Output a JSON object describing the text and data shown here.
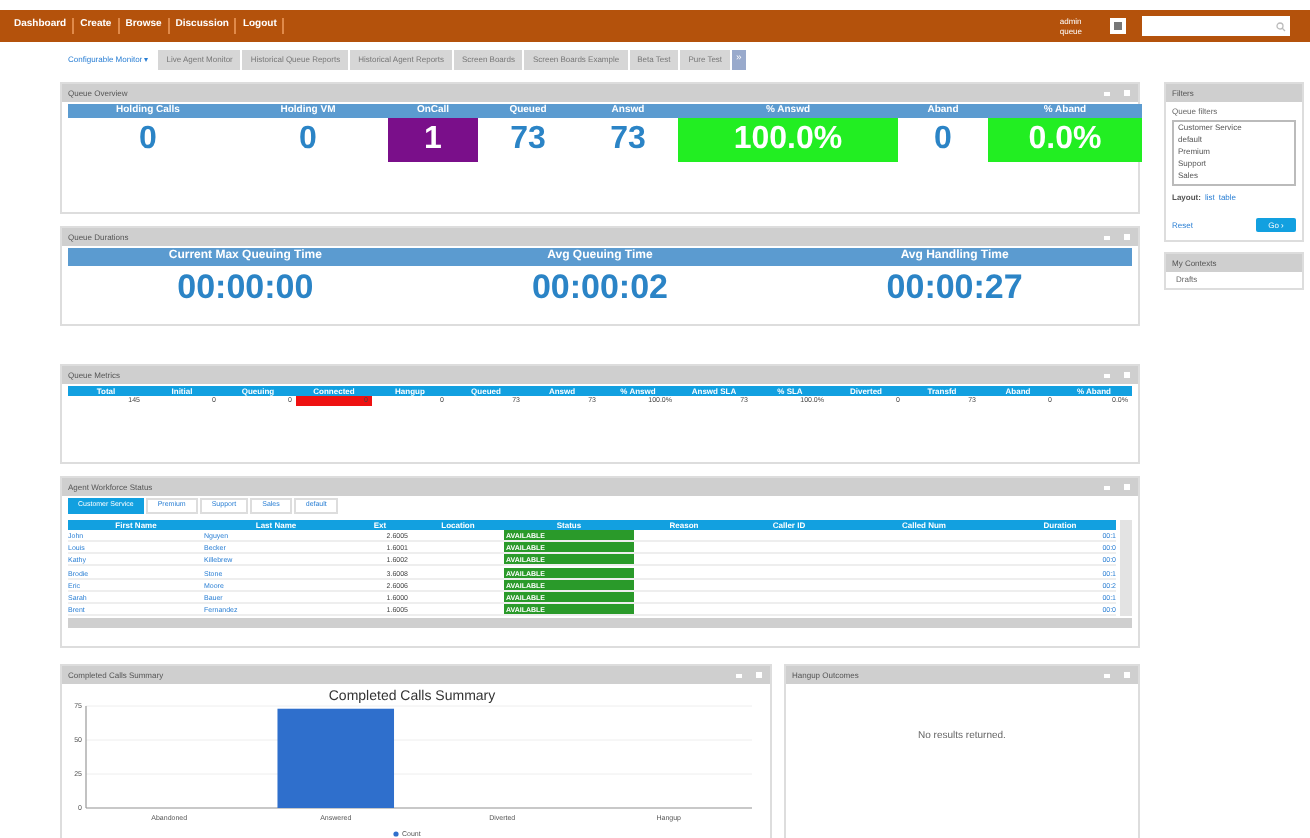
{
  "nav": {
    "items": [
      "Dashboard",
      "Create",
      "Browse",
      "Discussion",
      "Logout"
    ],
    "user": [
      "admin",
      "queue"
    ]
  },
  "tabs": [
    {
      "label": "Configurable Monitor ▾",
      "selected": true
    },
    {
      "label": "Live Agent Monitor",
      "selected": false
    },
    {
      "label": "Historical Queue Reports",
      "selected": false
    },
    {
      "label": "Historical Agent Reports",
      "selected": false
    },
    {
      "label": "Screen Boards",
      "selected": false
    },
    {
      "label": "Screen Boards Example",
      "selected": false
    },
    {
      "label": "Beta Test",
      "selected": false
    },
    {
      "label": "Pure Test",
      "selected": false
    }
  ],
  "tabs_more": "»",
  "queue_overview": {
    "title": "Queue Overview",
    "stats": [
      {
        "label": "Holding Calls",
        "value": "0"
      },
      {
        "label": "Holding VM",
        "value": "0"
      },
      {
        "label": "OnCall",
        "value": "1",
        "color": "#7a0f8a"
      },
      {
        "label": "Queued",
        "value": "73"
      },
      {
        "label": "Answd",
        "value": "73"
      },
      {
        "label": "% Answd",
        "value": "100.0%",
        "color": "#22ee22"
      },
      {
        "label": "Aband",
        "value": "0"
      },
      {
        "label": "% Aband",
        "value": "0.0%",
        "color": "#22ee22"
      }
    ]
  },
  "queue_durations": {
    "title": "Queue Durations",
    "stats": [
      {
        "label": "Current Max Queuing Time",
        "value": "00:00:00"
      },
      {
        "label": "Avg Queuing Time",
        "value": "00:00:02"
      },
      {
        "label": "Avg Handling Time",
        "value": "00:00:27"
      }
    ]
  },
  "queue_metrics": {
    "title": "Queue Metrics",
    "columns": [
      "Total",
      "Initial",
      "Queuing",
      "Connected",
      "Hangup",
      "Queued",
      "Answd",
      "% Answd",
      "Answd SLA",
      "% SLA",
      "Diverted",
      "Transfd",
      "Aband",
      "% Aband"
    ],
    "row": [
      {
        "text": "145"
      },
      {
        "text": "0"
      },
      {
        "text": "0"
      },
      {
        "text": "0",
        "color": "#ee1111"
      },
      {
        "text": "0"
      },
      {
        "text": "73"
      },
      {
        "text": "73"
      },
      {
        "text": "100.0%"
      },
      {
        "text": "73"
      },
      {
        "text": "100.0%"
      },
      {
        "text": "0"
      },
      {
        "text": "73"
      },
      {
        "text": "0"
      },
      {
        "text": "0.0%"
      }
    ]
  },
  "agent_status": {
    "title": "Agent Workforce Status",
    "tabs": [
      {
        "label": "Customer Service",
        "selected": true
      },
      {
        "label": "Premium",
        "selected": false
      },
      {
        "label": "Support",
        "selected": false
      },
      {
        "label": "Sales",
        "selected": false
      },
      {
        "label": "default",
        "selected": false
      }
    ],
    "columns": [
      "First Name",
      "Last Name",
      "Ext",
      "Location",
      "Status",
      "Reason",
      "Caller ID",
      "Called Num",
      "Duration"
    ],
    "rows": [
      {
        "first_name": "John",
        "last_name": "Nguyen",
        "ext": "2.6005",
        "status": "AVAILABLE",
        "duration": "00:1"
      },
      {
        "first_name": "Louis",
        "last_name": "Becker",
        "ext": "1.6001",
        "status": "AVAILABLE",
        "duration": "00:0"
      },
      {
        "first_name": "Kathy",
        "last_name": "Killebrew",
        "ext": "1.6002",
        "status": "AVAILABLE",
        "duration": "00:0"
      },
      {
        "first_name": "Brodie",
        "last_name": "Stone",
        "ext": "3.6008",
        "status": "AVAILABLE",
        "duration": "00:1"
      },
      {
        "first_name": "Eric",
        "last_name": "Moore",
        "ext": "2.6006",
        "status": "AVAILABLE",
        "duration": "00:2"
      },
      {
        "first_name": "Sarah",
        "last_name": "Bauer",
        "ext": "1.6000",
        "status": "AVAILABLE",
        "duration": "00:1"
      },
      {
        "first_name": "Brent",
        "last_name": "Fernandez",
        "ext": "1.6005",
        "status": "AVAILABLE",
        "duration": "00:0"
      }
    ]
  },
  "completed_calls": {
    "title": "Completed Calls Summary",
    "chart_data": {
      "type": "bar",
      "title": "Completed Calls Summary",
      "categories": [
        "Abandoned",
        "Answered",
        "Diverted",
        "Hangup"
      ],
      "series": [
        {
          "name": "Count",
          "color": "#2f6fcc",
          "values": [
            0,
            73,
            0,
            0
          ]
        }
      ],
      "ylim": [
        0,
        75
      ],
      "yticks": [
        0,
        25,
        50,
        75
      ]
    }
  },
  "hangup_outcomes": {
    "title": "Hangup Outcomes",
    "message": "No results returned."
  },
  "sidebar": {
    "filters_title": "Filters",
    "queue_filters_label": "Queue filters",
    "queues": [
      "Customer Service",
      "default",
      "Premium",
      "Support",
      "Sales"
    ],
    "layout_label": "Layout:",
    "layout_links": [
      "list",
      "table"
    ],
    "reset": "Reset",
    "go": "Go ›",
    "contexts_title": "My Contexts",
    "contexts": [
      "Drafts"
    ]
  }
}
